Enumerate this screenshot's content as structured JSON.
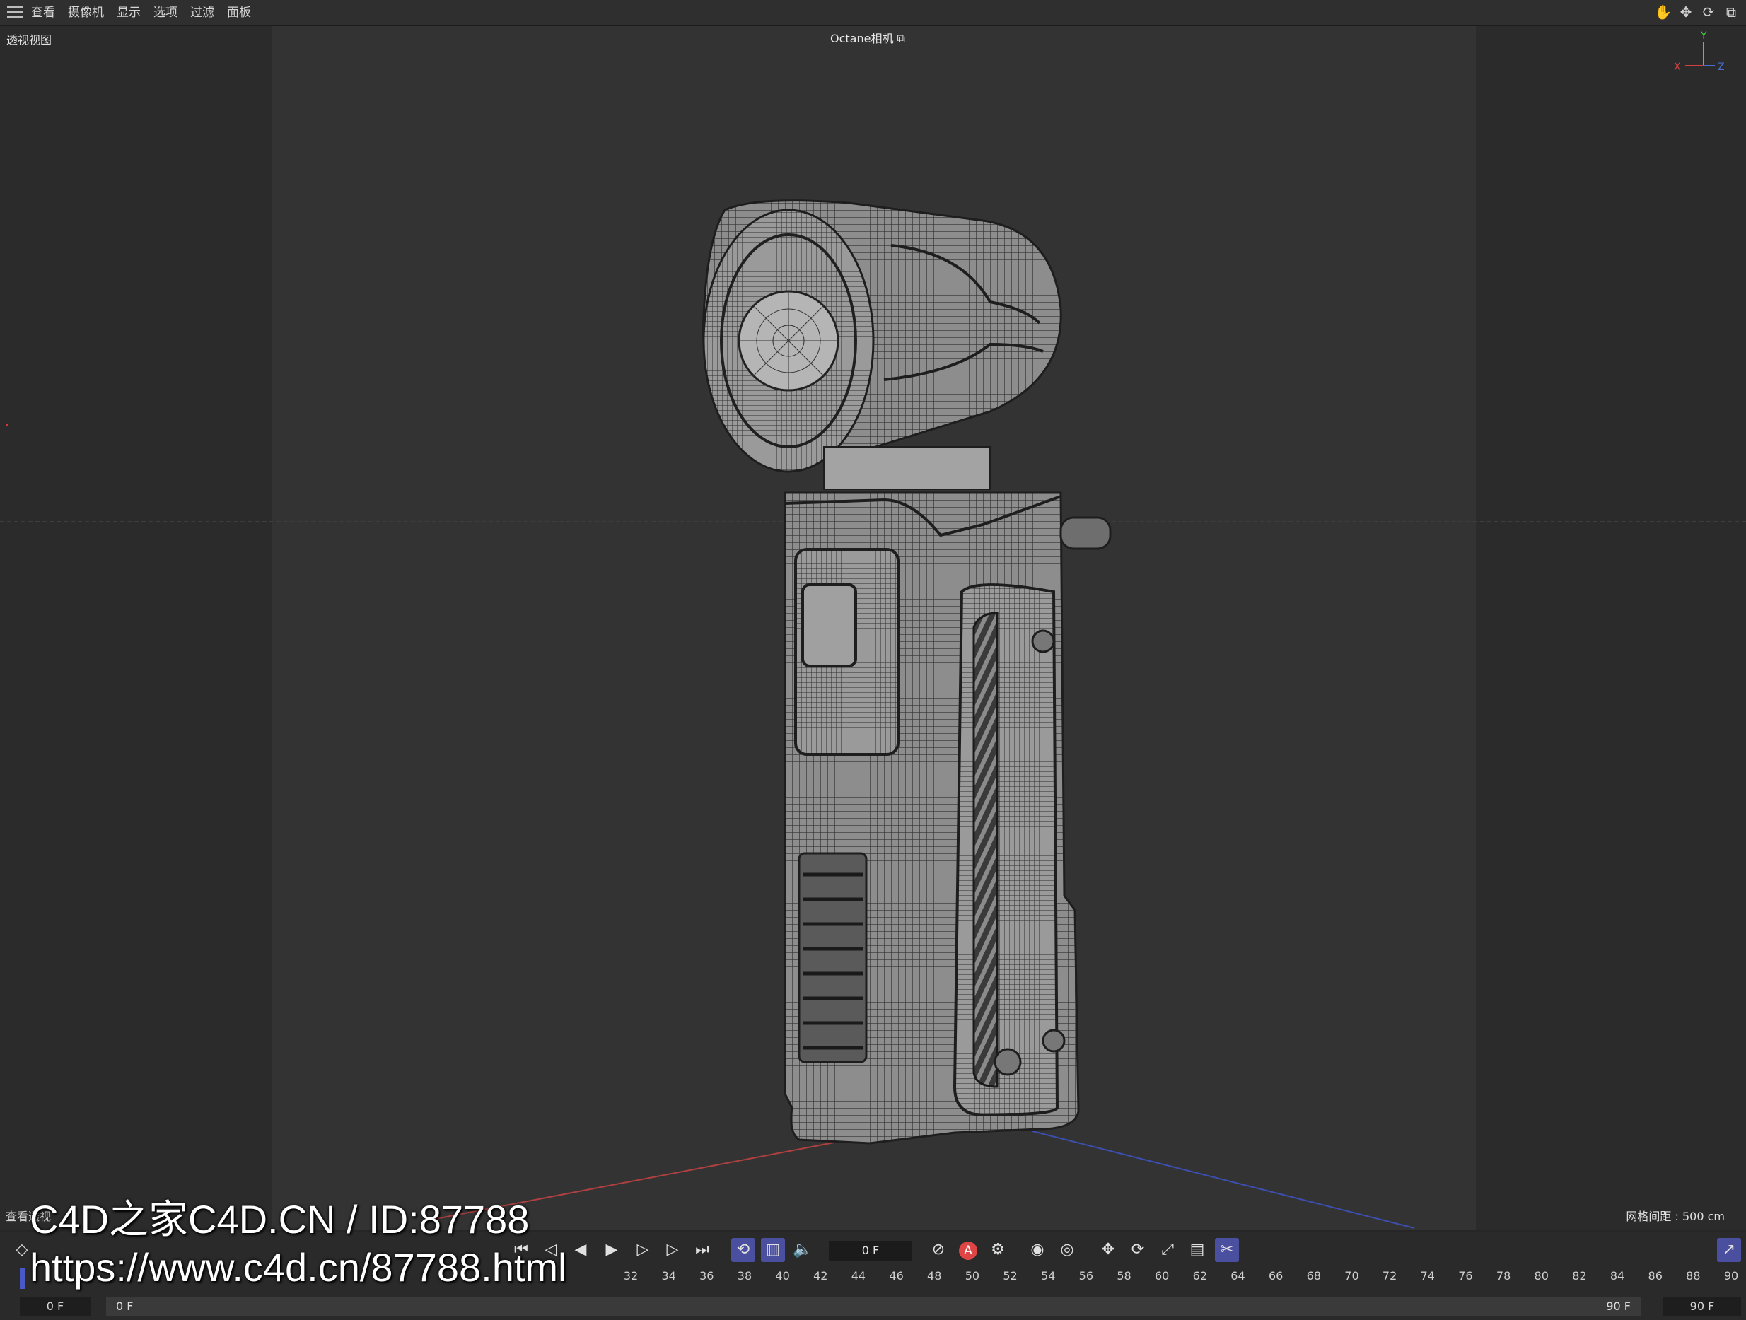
{
  "menubar": {
    "items": [
      "查看",
      "摄像机",
      "显示",
      "选项",
      "过滤",
      "面板"
    ],
    "nav_icons": [
      "hand-icon",
      "move-icon",
      "rotate-icon",
      "maximize-icon"
    ]
  },
  "viewport": {
    "view_name": "透视视图",
    "camera": "Octane相机",
    "grid_spacing": "网格间距 : 500 cm",
    "bottom_label": "查看透视",
    "axis": {
      "x": "X",
      "y": "Y",
      "z": "Z"
    }
  },
  "timeline": {
    "current_frame": "0 F",
    "ruler_ticks": [
      "32",
      "34",
      "36",
      "38",
      "40",
      "42",
      "44",
      "46",
      "48",
      "50",
      "52",
      "54",
      "56",
      "58",
      "60",
      "62",
      "64",
      "66",
      "68",
      "70",
      "72",
      "74",
      "76",
      "78",
      "80",
      "82",
      "84",
      "86",
      "88",
      "90"
    ],
    "range_start_field": "0 F",
    "range_start": "0 F",
    "range_end": "90 F",
    "range_end_field": "90 F",
    "colors": {
      "active": "#4b4fa0",
      "playhead": "#4b58c8",
      "record": "#e04545"
    }
  },
  "watermark": {
    "line1": "C4D之家C4D.CN / ID:87788",
    "line2": "https://www.c4d.cn/87788.html"
  }
}
